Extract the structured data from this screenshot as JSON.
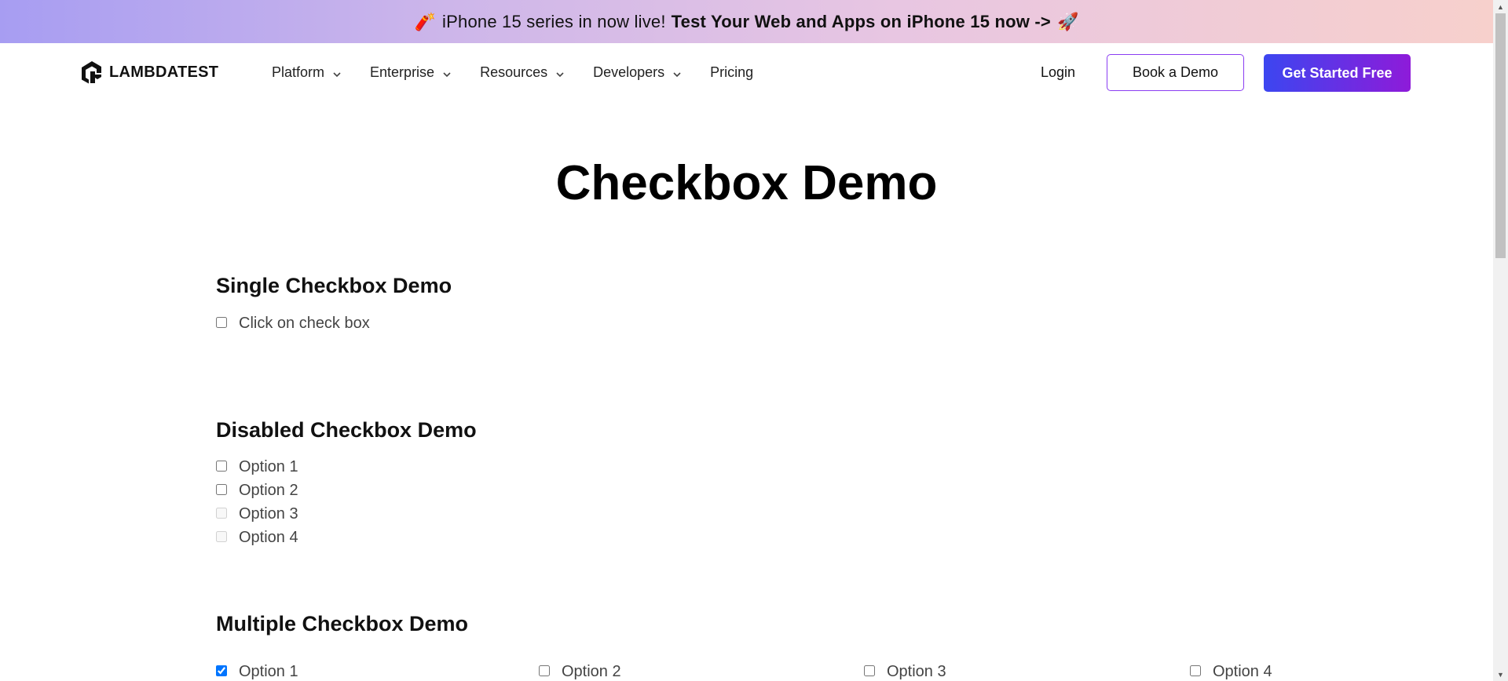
{
  "promo": {
    "emoji": "🧨",
    "text": "iPhone 15 series in now live!",
    "bold_text": "Test Your Web and Apps on iPhone 15 now ->",
    "rocket": "🚀"
  },
  "nav": {
    "logo_text": "LAMBDATEST",
    "menu": [
      {
        "label": "Platform",
        "has_dropdown": true
      },
      {
        "label": "Enterprise",
        "has_dropdown": true
      },
      {
        "label": "Resources",
        "has_dropdown": true
      },
      {
        "label": "Developers",
        "has_dropdown": true
      },
      {
        "label": "Pricing",
        "has_dropdown": false
      }
    ],
    "login": "Login",
    "book_demo": "Book a Demo",
    "get_started": "Get Started Free"
  },
  "page": {
    "title": "Checkbox Demo",
    "single": {
      "heading": "Single Checkbox Demo",
      "label": "Click on check box",
      "checked": false
    },
    "disabled": {
      "heading": "Disabled Checkbox Demo",
      "options": [
        {
          "label": "Option 1",
          "disabled": false
        },
        {
          "label": "Option 2",
          "disabled": false
        },
        {
          "label": "Option 3",
          "disabled": true
        },
        {
          "label": "Option 4",
          "disabled": true
        }
      ]
    },
    "multiple": {
      "heading": "Multiple Checkbox Demo",
      "options": [
        {
          "label": "Option 1",
          "checked": true
        },
        {
          "label": "Option 2",
          "checked": false
        },
        {
          "label": "Option 3",
          "checked": false
        },
        {
          "label": "Option 4",
          "checked": false
        }
      ]
    }
  },
  "colors": {
    "accent_gradient_start": "#3c46f0",
    "accent_gradient_end": "#8e1bd9",
    "checkbox_checked": "#0b57d0"
  }
}
